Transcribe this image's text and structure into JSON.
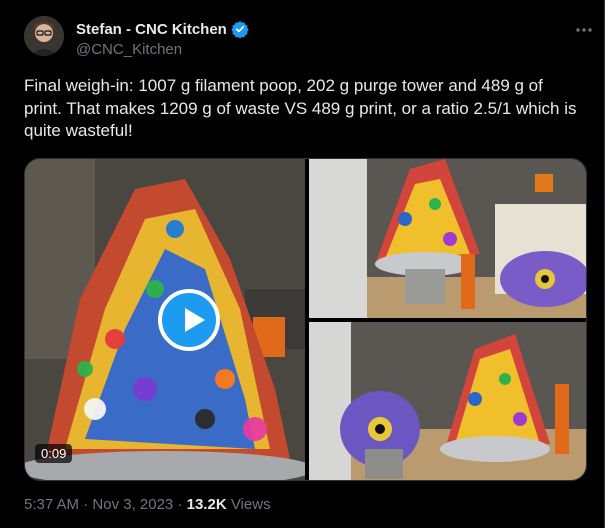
{
  "author": {
    "display_name": "Stefan - CNC Kitchen",
    "handle": "@CNC_Kitchen",
    "verified_color": "#1d9bf0"
  },
  "more_icon": "more-horizontal-icon",
  "tweet": {
    "text": "Final weigh-in: 1007 g filament poop, 202 g purge tower and 489 g  of print. That makes 1209 g of waste VS 489 g print, or a ratio 2.5/1 which is quite wasteful!"
  },
  "media": {
    "video_duration": "0:09"
  },
  "footer": {
    "time": "5:37 AM",
    "sep1": "·",
    "date": "Nov 3, 2023",
    "sep2": "·",
    "views_count": "13.2K",
    "views_label": "Views"
  },
  "colors": {
    "background": "#000000",
    "text": "#e7e9ea",
    "secondary": "#71767b",
    "accent": "#1d9bf0"
  }
}
